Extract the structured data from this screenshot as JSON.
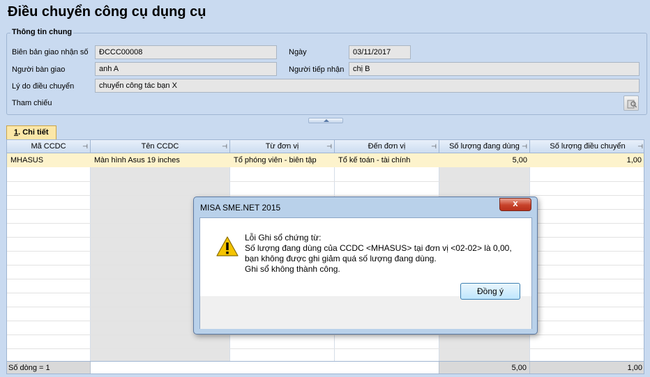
{
  "page": {
    "title": "Điều chuyển công cụ dụng cụ"
  },
  "general": {
    "legend": "Thông tin chung",
    "doc_no_label": "Biên bản giao nhận số",
    "doc_no_value": "ĐCCC00008",
    "date_label": "Ngày",
    "date_value": "03/11/2017",
    "giver_label": "Người bàn giao",
    "giver_value": "anh A",
    "receiver_label": "Người tiếp nhận",
    "receiver_value": "chị B",
    "reason_label": "Lý do điều chuyển",
    "reason_value": "chuyển công tác bạn X",
    "reference_label": "Tham chiếu"
  },
  "tab": {
    "label_num": "1",
    "label_rest": ". Chi tiết"
  },
  "grid": {
    "columns": [
      "Mã CCDC",
      "Tên CCDC",
      "Từ đơn vị",
      "Đến đơn vị",
      "Số lượng đang dùng",
      "Số lượng điều chuyển"
    ],
    "rows": [
      {
        "code": "MHASUS",
        "name": "Màn hình Asus 19 inches",
        "from": "Tổ phóng viên - biên tập",
        "to": "Tổ kế toán - tài chính",
        "qty_in_use": "5,00",
        "qty_transfer": "1,00"
      }
    ],
    "footer": {
      "row_count": "Số dòng = 1",
      "total_in_use": "5,00",
      "total_transfer": "1,00"
    }
  },
  "dialog": {
    "title": "MISA SME.NET 2015",
    "close_glyph": "x",
    "message_lines": [
      "Lỗi Ghi sổ chứng từ:",
      "Số lượng đang dùng của CCDC <MHASUS> tại đơn vị <02-02> là 0,00,",
      "bạn không được ghi giảm quá số lượng đang dùng.",
      "Ghi sổ không thành công."
    ],
    "ok_label": "Đồng ý"
  },
  "colors": {
    "background": "#c9daf0",
    "selected_row": "#fdf3cc",
    "tab": "#fbe7a8"
  }
}
